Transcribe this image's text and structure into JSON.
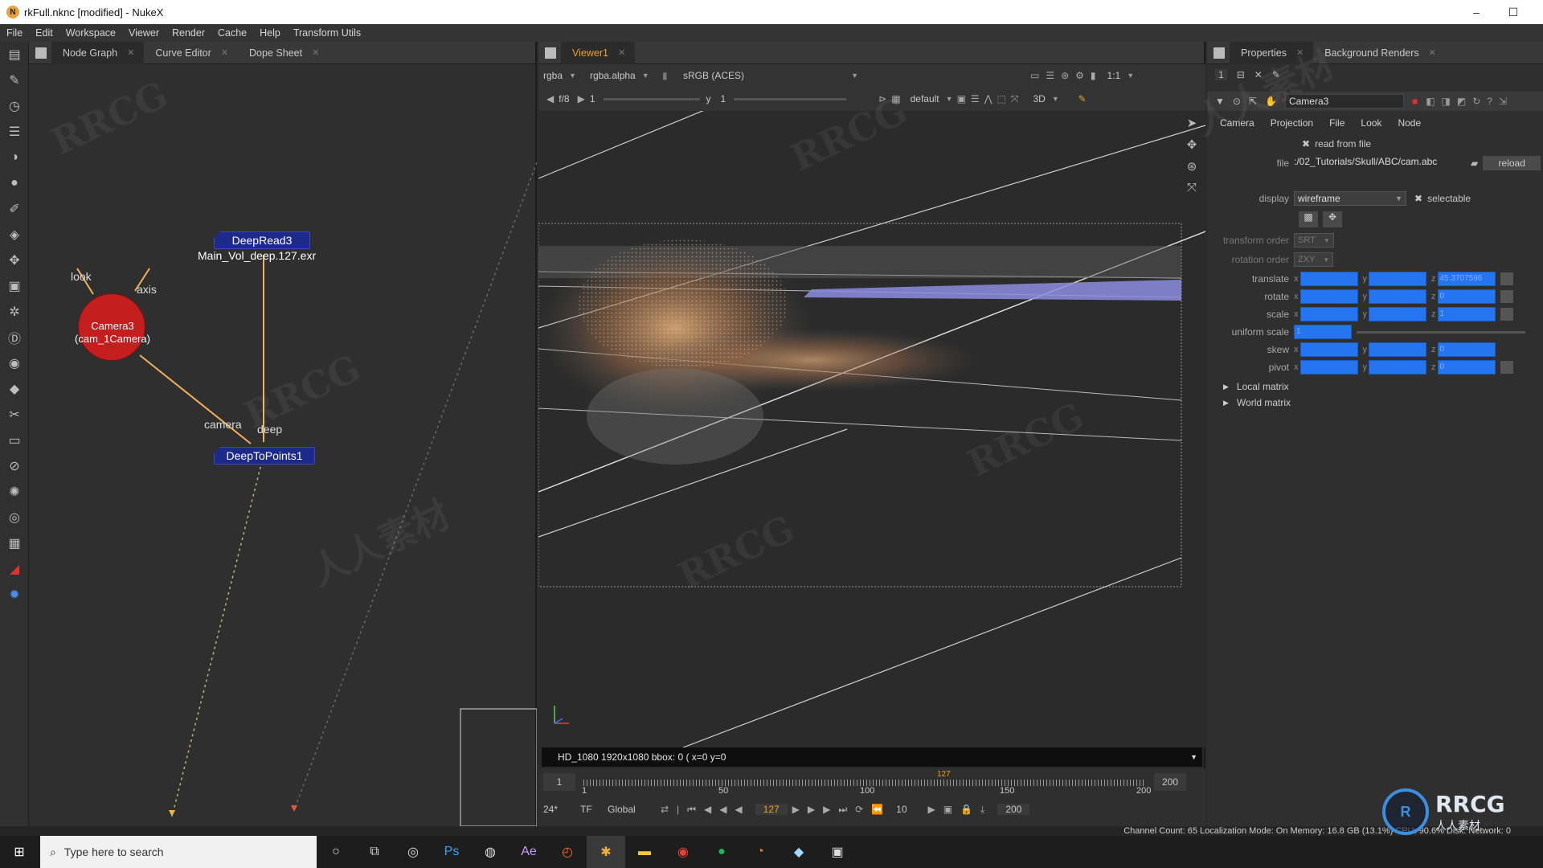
{
  "window": {
    "title": "rkFull.nknc [modified] - NukeX",
    "minimize": "–",
    "maximize": "☐"
  },
  "menu": [
    "File",
    "Edit",
    "Workspace",
    "Viewer",
    "Render",
    "Cache",
    "Help",
    "Transform Utils"
  ],
  "left_panel": {
    "tabs": [
      {
        "label": "Node Graph"
      },
      {
        "label": "Curve Editor"
      },
      {
        "label": "Dope Sheet"
      }
    ],
    "nodes": {
      "deepread": {
        "name": "DeepRead3",
        "file": "Main_Vol_deep.127.exr"
      },
      "camera": {
        "name": "Camera3",
        "sub": "(cam_1Camera)",
        "inputs": [
          "look",
          "axis"
        ]
      },
      "deeptopoints": {
        "name": "DeepToPoints1",
        "inputs": [
          "camera",
          "deep"
        ]
      }
    }
  },
  "viewer": {
    "tab": "Viewer1",
    "channels": "rgba",
    "alpha": "rgba.alpha",
    "colorspace": "sRGB (ACES)",
    "zoom": "1:1",
    "fstop": "f/8",
    "gain": "1",
    "gamma_label": "y",
    "gamma": "1",
    "lut": "default",
    "mode": "3D",
    "status": "HD_1080 1920x1080  bbox: 0 (  x=0 y=0",
    "timeline": {
      "start": "1",
      "end": "200",
      "ticks": [
        "1",
        "50",
        "100",
        "150",
        "200"
      ],
      "current": "127",
      "fps": "24*",
      "tf": "TF",
      "scope": "Global",
      "step": "10",
      "out": "200"
    }
  },
  "properties": {
    "tabs": [
      {
        "label": "Properties"
      },
      {
        "label": "Background Renders"
      }
    ],
    "count": "1",
    "node_name": "Camera3",
    "subtabs": [
      "Camera",
      "Projection",
      "File",
      "Look",
      "Node"
    ],
    "read_from_file_label": "read from file",
    "file_label": "file",
    "file_value": ":/02_Tutorials/Skull/ABC/cam.abc",
    "reload": "reload",
    "display_label": "display",
    "display_value": "wireframe",
    "selectable_label": "selectable",
    "transform_order_label": "transform order",
    "transform_order_value": "SRT",
    "rotation_order_label": "rotation order",
    "rotation_order_value": "ZXY",
    "rows": [
      {
        "label": "translate",
        "z": "45.3707596"
      },
      {
        "label": "rotate",
        "z": "0"
      },
      {
        "label": "scale",
        "z": "1"
      },
      {
        "label": "uniform scale",
        "z": "1"
      },
      {
        "label": "skew",
        "z": "0"
      },
      {
        "label": "pivot",
        "z": "0"
      }
    ],
    "local_matrix": "Local matrix",
    "world_matrix": "World matrix"
  },
  "status_bar": "Channel Count: 65  Localization Mode: On  Memory: 16.8 GB (13.1%)  CPU: 90.6%  Disk:   Network: 0",
  "taskbar": {
    "search_placeholder": "Type here to search"
  },
  "watermark": "RRCG",
  "watermark_cn": "人人素材",
  "brand": {
    "name": "RRCG",
    "sub": "人人素材"
  }
}
